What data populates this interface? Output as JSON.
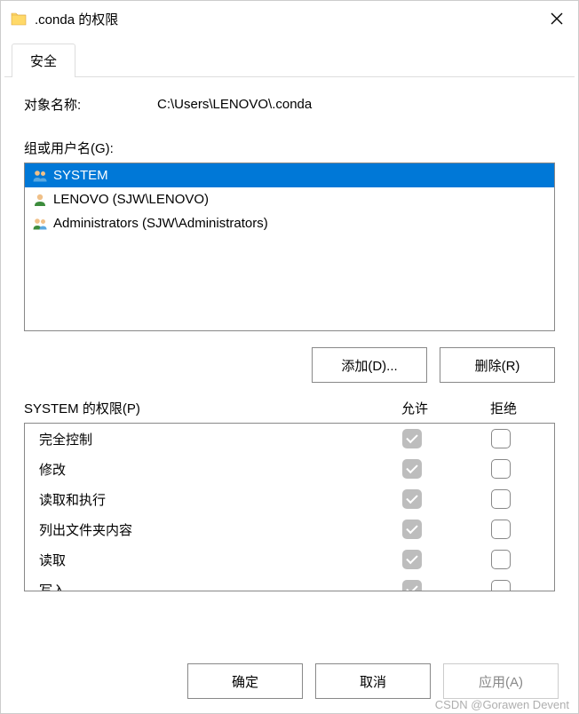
{
  "title": ".conda 的权限",
  "tab": "安全",
  "object_label": "对象名称:",
  "object_value": "C:\\Users\\LENOVO\\.conda",
  "group_label": "组或用户名(G):",
  "users": [
    {
      "name": "SYSTEM",
      "icon": "two-users",
      "selected": true
    },
    {
      "name": "LENOVO (SJW\\LENOVO)",
      "icon": "single-user",
      "selected": false
    },
    {
      "name": "Administrators (SJW\\Administrators)",
      "icon": "two-users-alt",
      "selected": false
    }
  ],
  "buttons": {
    "add": "添加(D)...",
    "remove": "删除(R)",
    "ok": "确定",
    "cancel": "取消",
    "apply": "应用(A)"
  },
  "perm_title": "SYSTEM 的权限(P)",
  "perm_allow": "允许",
  "perm_deny": "拒绝",
  "permissions": [
    {
      "name": "完全控制",
      "allow": true,
      "deny": false
    },
    {
      "name": "修改",
      "allow": true,
      "deny": false
    },
    {
      "name": "读取和执行",
      "allow": true,
      "deny": false
    },
    {
      "name": "列出文件夹内容",
      "allow": true,
      "deny": false
    },
    {
      "name": "读取",
      "allow": true,
      "deny": false
    },
    {
      "name": "写入",
      "allow": true,
      "deny": false
    }
  ],
  "watermark": "CSDN @Gorawen Devent"
}
